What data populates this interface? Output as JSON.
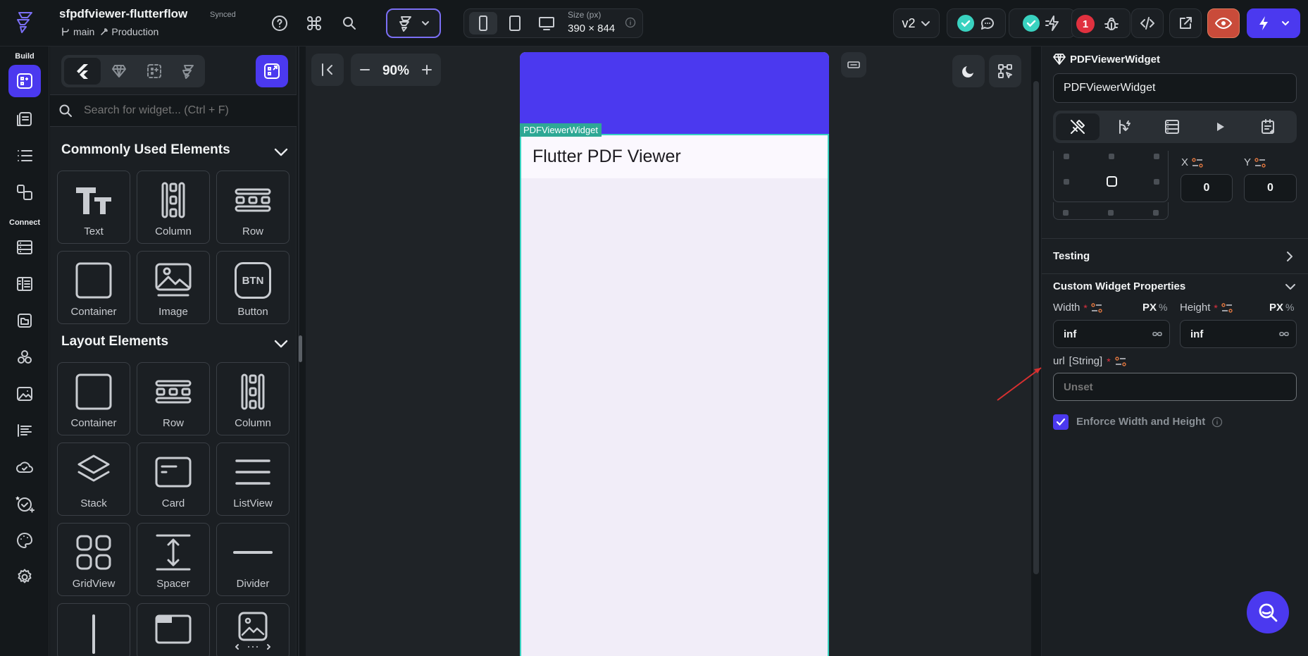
{
  "header": {
    "project_title": "sfpdfviewer-flutterflow",
    "sync_status": "Synced",
    "branch": "main",
    "environment": "Production",
    "size_label": "Size (px)",
    "size_value": "390 × 844",
    "version": "v2",
    "error_count": "1"
  },
  "panel": {
    "search_placeholder": "Search for widget... (Ctrl + F)",
    "sections": [
      {
        "title": "Commonly Used Elements",
        "items": [
          "Text",
          "Column",
          "Row",
          "Container",
          "Image",
          "Button"
        ]
      },
      {
        "title": "Layout Elements",
        "items": [
          "Container",
          "Row",
          "Column",
          "Stack",
          "Card",
          "ListView",
          "GridView",
          "Spacer",
          "Divider"
        ]
      }
    ],
    "button_glyph": "BTN"
  },
  "rail": {
    "build": "Build",
    "connect": "Connect"
  },
  "canvas": {
    "zoom": "90%",
    "widget_tag": "PDFViewerWidget",
    "app_title": "Flutter PDF Viewer"
  },
  "props": {
    "widget_name": "PDFViewerWidget",
    "name_value": "PDFViewerWidget",
    "x_label": "X",
    "y_label": "Y",
    "x_value": "0",
    "y_value": "0",
    "testing_label": "Testing",
    "custom_props_title": "Custom Widget Properties",
    "width_label": "Width",
    "height_label": "Height",
    "px": "PX",
    "pct": "%",
    "width_value": "inf",
    "height_value": "inf",
    "url_label": "url",
    "url_type": "[String]",
    "url_placeholder": "Unset",
    "enforce_label": "Enforce Width and Height"
  },
  "colors": {
    "accent": "#4b39ef",
    "teal": "#39d2c0",
    "error": "#e0313f",
    "app_header": "#4b39ef"
  }
}
